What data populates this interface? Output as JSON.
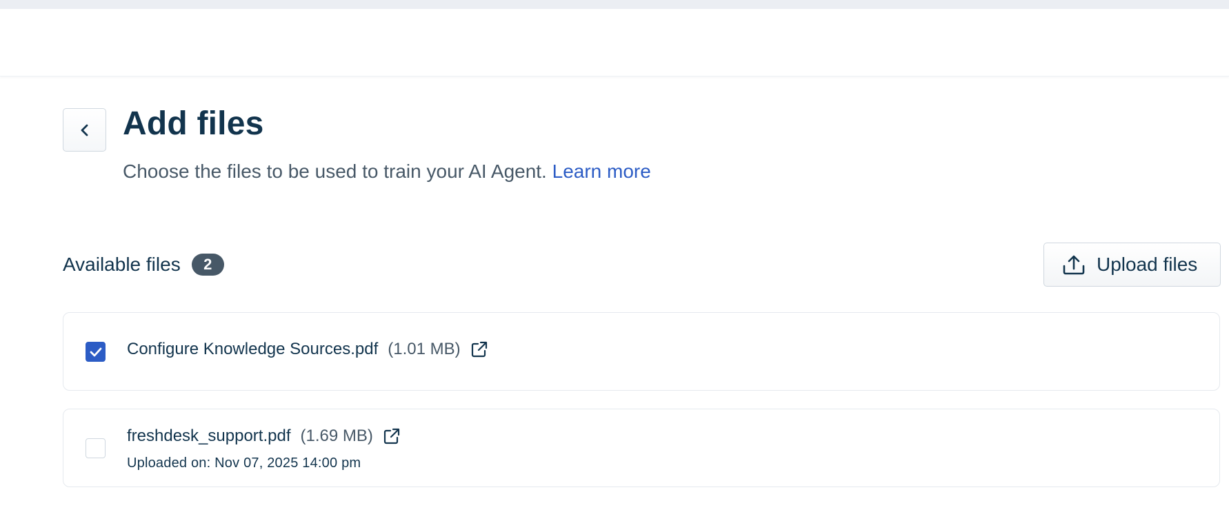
{
  "page": {
    "title": "Add files",
    "subtitle": "Choose the files to be used to train your AI Agent.",
    "learn_more": "Learn more"
  },
  "files_section": {
    "label": "Available files",
    "count": "2",
    "upload_label": "Upload files"
  },
  "files": [
    {
      "name": "Configure Knowledge Sources.pdf",
      "size": "(1.01 MB)",
      "checked": true,
      "uploaded_on": ""
    },
    {
      "name": "freshdesk_support.pdf",
      "size": "(1.69 MB)",
      "checked": false,
      "uploaded_on": "Uploaded on: Nov 07, 2025 14:00 pm"
    }
  ],
  "icons": {
    "back": "chevron-left-icon",
    "upload": "upload-icon",
    "external": "external-link-icon",
    "check": "check-icon"
  },
  "colors": {
    "primary": "#2c5cc5",
    "text": "#12344d",
    "muted": "#475867",
    "badge": "#475867",
    "border": "#cfd7df"
  }
}
